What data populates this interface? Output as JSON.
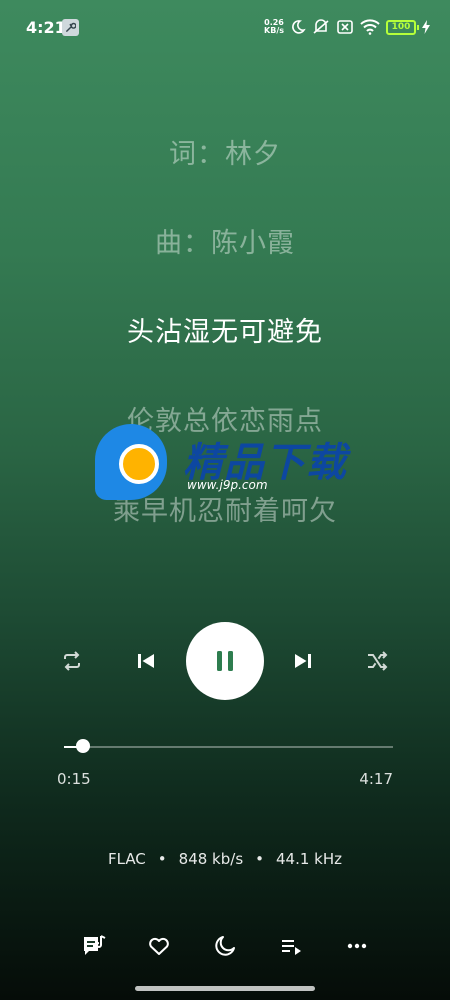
{
  "status_bar": {
    "time": "4:21",
    "net_speed_value": "0.26",
    "net_speed_unit": "KB/s",
    "battery": "100"
  },
  "lyrics": [
    {
      "text": "词：林夕",
      "state": "past"
    },
    {
      "text": "曲：陈小霞",
      "state": "past"
    },
    {
      "text": "头沾湿无可避免",
      "state": "current"
    },
    {
      "text": "伦敦总依恋雨点",
      "state": "upcoming"
    },
    {
      "text": "乘早机忍耐着呵欠",
      "state": "upcoming"
    }
  ],
  "watermark": {
    "title": "精品下载",
    "url": "www.j9p.com"
  },
  "controls": {
    "repeat_icon": "repeat-icon",
    "previous_icon": "skip-previous-icon",
    "play_pause_icon": "pause-icon",
    "next_icon": "skip-next-icon",
    "shuffle_icon": "shuffle-icon"
  },
  "progress": {
    "current_time": "0:15",
    "total_time": "4:17",
    "fraction": 0.058
  },
  "audio_info": {
    "format": "FLAC",
    "bitrate": "848 kb/s",
    "sample_rate": "44.1 kHz",
    "separator": "•"
  },
  "bottom_bar": [
    {
      "icon": "lyrics-icon"
    },
    {
      "icon": "heart-icon"
    },
    {
      "icon": "sleep-timer-moon-icon"
    },
    {
      "icon": "playlist-icon"
    },
    {
      "icon": "more-icon"
    }
  ],
  "colors": {
    "bg_top": "#3e8a5e",
    "bg_bottom": "#050c08",
    "accent": "#2e7d4f",
    "battery": "#b6ff3a"
  }
}
